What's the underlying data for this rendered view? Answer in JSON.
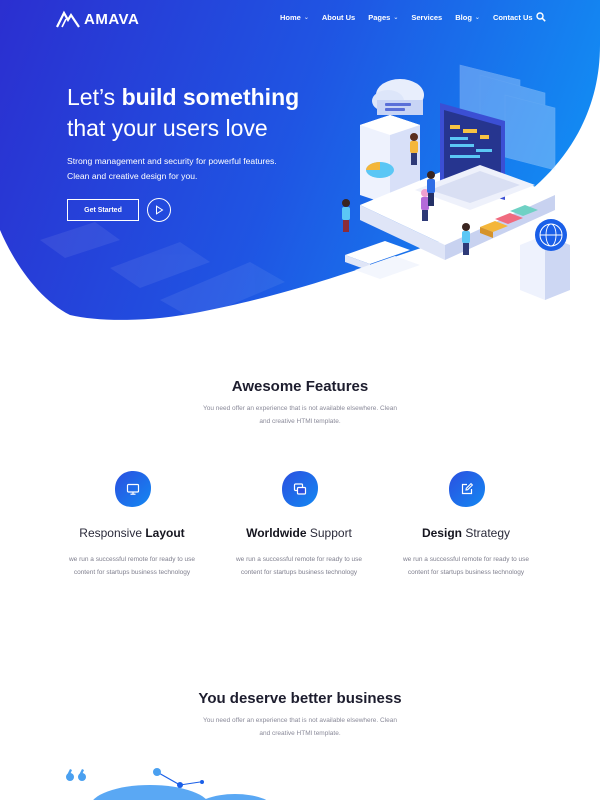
{
  "nav": {
    "logo_text": "AMAVA",
    "items": [
      {
        "label": "Home",
        "has_dropdown": true
      },
      {
        "label": "About Us",
        "has_dropdown": false
      },
      {
        "label": "Pages",
        "has_dropdown": true
      },
      {
        "label": "Services",
        "has_dropdown": false
      },
      {
        "label": "Blog",
        "has_dropdown": true
      },
      {
        "label": "Contact Us",
        "has_dropdown": false
      }
    ],
    "chevron": "⌄",
    "search_icon": "search-icon"
  },
  "hero": {
    "title_part1": "Let’s ",
    "title_bold": "build something",
    "title_line2": "that your users love",
    "subtitle": "Strong management and security for powerful features. Clean and creative design for you.",
    "cta_label": "Get Started",
    "play_icon": "play-icon",
    "colors": {
      "gradient_start": "#2a2fcf",
      "gradient_end": "#1479ee"
    }
  },
  "features_section": {
    "title": "Awesome Features",
    "desc": "You need offer an experience that is not available elsewhere. Clean and creative HTMl template.",
    "items": [
      {
        "title_light": "Responsive ",
        "title_bold": "Layout",
        "order": "light-first",
        "text": "we run a successful remote for ready to use content for startups business technology",
        "icon": "monitor-icon"
      },
      {
        "title_light": " Support",
        "title_bold": "Worldwide",
        "order": "bold-first",
        "text": "we run a successful remote for ready to use content for startups business technology",
        "icon": "windows-icon"
      },
      {
        "title_light": " Strategy",
        "title_bold": "Design",
        "order": "bold-first",
        "text": "we run a successful remote for ready to use content for startups business technology",
        "icon": "edit-icon"
      }
    ]
  },
  "business_section": {
    "title": "You deserve better business",
    "desc": "You need offer an experience that is not available elsewhere. Clean and creative HTMl template."
  },
  "accent_color": "#1a5fe8"
}
